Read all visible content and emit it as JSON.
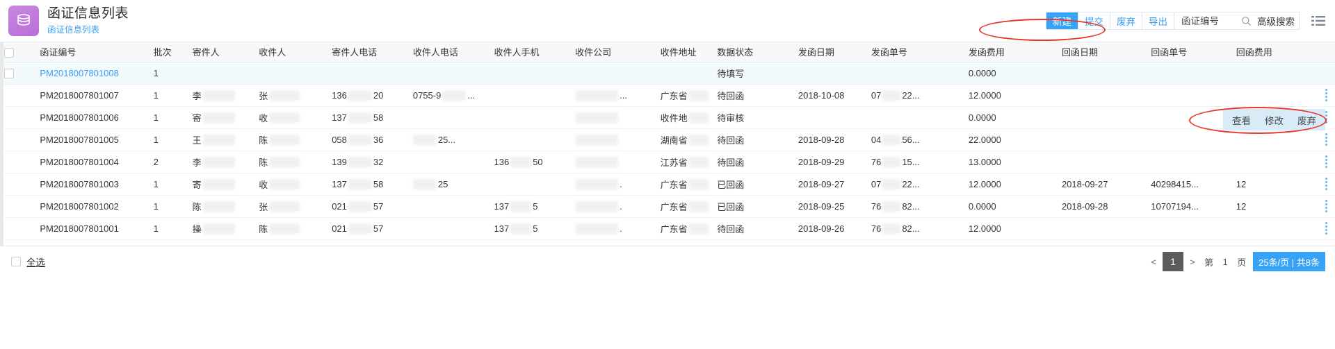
{
  "header": {
    "logo_icon": "database-stack-icon",
    "title": "函证信息列表",
    "breadcrumb": "函证信息列表"
  },
  "toolbar": {
    "buttons": [
      {
        "label": "新建",
        "primary": true
      },
      {
        "label": "提交",
        "primary": false
      },
      {
        "label": "废弃",
        "primary": false
      },
      {
        "label": "导出",
        "primary": false
      }
    ],
    "search_placeholder": "函证编号",
    "search_value": "",
    "search_icon": "search-icon",
    "advanced_search_label": "高级搜索",
    "menu_icon": "list-menu-icon"
  },
  "annotations": {
    "toolbar_ellipse": "red-ellipse-toolbar",
    "row_actions_ellipse": "red-ellipse-row-actions"
  },
  "table": {
    "columns": [
      "函证编号",
      "批次",
      "寄件人",
      "收件人",
      "寄件人电话",
      "收件人电话",
      "收件人手机",
      "收件公司",
      "收件地址",
      "数据状态",
      "发函日期",
      "发函单号",
      "发函费用",
      "回函日期",
      "回函单号",
      "回函费用"
    ],
    "rows": [
      {
        "code": "PM2018007801008",
        "batch": "1",
        "sender": "",
        "receiver": "",
        "sender_phone": "",
        "receiver_phone": "",
        "receiver_mobile": "",
        "receiver_company": "",
        "receiver_address": "",
        "status": "待填写",
        "send_date": "",
        "send_no": "",
        "send_fee": "0.0000",
        "reply_date": "",
        "reply_no": "",
        "reply_fee": "",
        "hovered": true
      },
      {
        "code": "PM2018007801007",
        "batch": "1",
        "sender": "李",
        "receiver": "张",
        "sender_phone": "136",
        "sender_phone_tail": "20",
        "receiver_phone": "0755-9",
        "receiver_phone_tail": "...",
        "receiver_mobile": "",
        "receiver_company": "",
        "receiver_company_tail": "...",
        "receiver_address": "广东省",
        "status": "待回函",
        "send_date": "2018-10-08",
        "send_no": "07",
        "send_no_tail": "22...",
        "send_fee": "12.0000",
        "reply_date": "",
        "reply_no": "",
        "reply_fee": "",
        "hovered": false
      },
      {
        "code": "PM2018007801006",
        "batch": "1",
        "sender": "寄",
        "receiver": "收",
        "sender_phone": "137",
        "sender_phone_tail": "58",
        "receiver_phone": "",
        "receiver_phone_tail": "",
        "receiver_mobile": "",
        "receiver_company": "",
        "receiver_address": "收件地",
        "status": "待审核",
        "send_date": "",
        "send_no": "",
        "send_fee": "0.0000",
        "reply_date": "",
        "reply_no": "",
        "reply_fee": "",
        "hovered": false
      },
      {
        "code": "PM2018007801005",
        "batch": "1",
        "sender": "王",
        "receiver": "陈",
        "sender_phone": "058",
        "sender_phone_tail": "36",
        "receiver_phone": "",
        "receiver_phone_tail": "25...",
        "receiver_mobile": "",
        "receiver_company": "",
        "receiver_address": "湖南省",
        "status": "待回函",
        "send_date": "2018-09-28",
        "send_no": "04",
        "send_no_tail": "56...",
        "send_fee": "22.0000",
        "reply_date": "",
        "reply_no": "",
        "reply_fee": "",
        "hovered": false
      },
      {
        "code": "PM2018007801004",
        "batch": "2",
        "sender": "李",
        "receiver": "陈",
        "sender_phone": "139",
        "sender_phone_tail": "32",
        "receiver_phone": "",
        "receiver_phone_tail": "",
        "receiver_mobile": "136",
        "receiver_mobile_tail": "50",
        "receiver_company": "",
        "receiver_address": "江苏省",
        "status": "待回函",
        "send_date": "2018-09-29",
        "send_no": "76",
        "send_no_tail": "15...",
        "send_fee": "13.0000",
        "reply_date": "",
        "reply_no": "",
        "reply_fee": "",
        "hovered": false
      },
      {
        "code": "PM2018007801003",
        "batch": "1",
        "sender": "寄",
        "receiver": "收",
        "sender_phone": "137",
        "sender_phone_tail": "58",
        "receiver_phone": "",
        "receiver_phone_tail": "25",
        "receiver_mobile": "",
        "receiver_company": "",
        "receiver_company_tail": ".",
        "receiver_address": "广东省",
        "status": "已回函",
        "send_date": "2018-09-27",
        "send_no": "07",
        "send_no_tail": "22...",
        "send_fee": "12.0000",
        "reply_date": "2018-09-27",
        "reply_no": "40298415...",
        "reply_fee": "12",
        "hovered": false
      },
      {
        "code": "PM2018007801002",
        "batch": "1",
        "sender": "陈",
        "receiver": "张",
        "sender_phone": "021",
        "sender_phone_tail": "57",
        "receiver_phone": "",
        "receiver_phone_tail": "",
        "receiver_mobile": "137",
        "receiver_mobile_tail": "5",
        "receiver_company": "",
        "receiver_company_tail": ".",
        "receiver_address": "广东省",
        "status": "已回函",
        "send_date": "2018-09-25",
        "send_no": "76",
        "send_no_tail": "82...",
        "send_fee": "0.0000",
        "reply_date": "2018-09-28",
        "reply_no": "10707194...",
        "reply_fee": "12",
        "hovered": false
      },
      {
        "code": "PM2018007801001",
        "batch": "1",
        "sender": "操",
        "receiver": "陈",
        "sender_phone": "021",
        "sender_phone_tail": "57",
        "receiver_phone": "",
        "receiver_phone_tail": "",
        "receiver_mobile": "137",
        "receiver_mobile_tail": "5",
        "receiver_company": "",
        "receiver_company_tail": ".",
        "receiver_address": "广东省",
        "status": "待回函",
        "send_date": "2018-09-26",
        "send_no": "76",
        "send_no_tail": "82...",
        "send_fee": "12.0000",
        "reply_date": "",
        "reply_no": "",
        "reply_fee": "",
        "hovered": false
      }
    ]
  },
  "row_actions": {
    "view_label": "查看",
    "edit_label": "修改",
    "discard_label": "废弃"
  },
  "footer": {
    "select_all_label": "全选",
    "prev_label": "<",
    "next_label": ">",
    "current_page": "1",
    "jump_prefix": "第",
    "jump_value": "1",
    "jump_suffix": "页",
    "total_label": "25条/页 | 共8条"
  },
  "colors": {
    "primary": "#36a3f7",
    "link": "#3b9ff5",
    "annotation": "#e8342a",
    "logo": "#bd77d9",
    "row_hover": "#f3fafb"
  }
}
